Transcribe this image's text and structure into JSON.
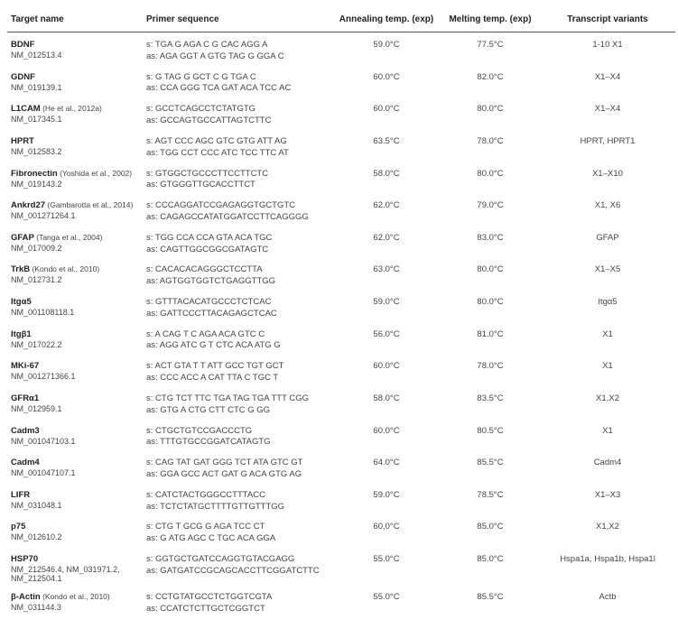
{
  "headers": {
    "target": "Target name",
    "primer": "Primer sequence",
    "anneal": "Annealing temp. (exp)",
    "melt": "Melting temp. (exp)",
    "variants": "Transcript variants"
  },
  "rows": [
    {
      "name": "BDNF",
      "ref": "",
      "accession": "NM_012513.4",
      "s": "s: TGA G AGA C G CAC AGG A",
      "as": "as: AGA GGT A GTG TAG G GGA C",
      "anneal": "59.0°C",
      "melt": "77.5°C",
      "variants": "1-10 X1"
    },
    {
      "name": "GDNF",
      "ref": "",
      "accession": "NM_019139.1",
      "s": "s: G TAG G GCT C G TGA C",
      "as": "as: CCA GGG TCA GAT ACA TCC AC",
      "anneal": "60.0°C",
      "melt": "82.0°C",
      "variants": "X1–X4"
    },
    {
      "name": "L1CAM",
      "ref": "(He et al., 2012a)",
      "accession": "NM_017345.1",
      "s": "s: GCCTCAGCCTCTATGTG",
      "as": "as: GCCAGTGCCATTAGTCTTC",
      "anneal": "60.0°C",
      "melt": "80.0°C",
      "variants": "X1–X4"
    },
    {
      "name": "HPRT",
      "ref": "",
      "accession": "NM_012583.2",
      "s": "s: AGT CCC AGC GTC GTG ATT AG",
      "as": "as: TGG CCT CCC ATC TCC TTC AT",
      "anneal": "63.5°C",
      "melt": "78.0°C",
      "variants": "HPRT, HPRT1"
    },
    {
      "name": "Fibronectin",
      "ref": "(Yoshida et al., 2002)",
      "accession": "NM_019143.2",
      "s": "s: GTGGCTGCCCTTCCTTCTC",
      "as": "as: GTGGGTTGCACCTTCT",
      "anneal": "58.0°C",
      "melt": "80.0°C",
      "variants": "X1–X10"
    },
    {
      "name": "Ankrd27",
      "ref": "(Gambarotta et al., 2014)",
      "accession": "NM_001271264.1",
      "s": "s: CCCAGGATCCGAGAGGTGCTGTC",
      "as": "as: CAGAGCCATATGGATCCTTCAGGGG",
      "anneal": "62.0°C",
      "melt": "79.0°C",
      "variants": "X1, X6"
    },
    {
      "name": "GFAP",
      "ref": "(Tanga et al., 2004)",
      "accession": "NM_017009.2",
      "s": "s: TGG CCA CCA GTA ACA TGC",
      "as": "as: CAGTTGGCGGCGATAGTC",
      "anneal": "62.0°C",
      "melt": "83.0°C",
      "variants": "GFAP"
    },
    {
      "name": "TrkB",
      "ref": "(Kondo et al., 2010)",
      "accession": "NM_012731.2",
      "s": "s: CACACACAGGGCTCCTTA",
      "as": "as: AGTGGTGGTCTGAGGTTGG",
      "anneal": "63.0°C",
      "melt": "80.0°C",
      "variants": "X1–X5"
    },
    {
      "name": "Itgα5",
      "ref": "",
      "accession": "NM_001108118.1",
      "s": "s: GTTTACACATGCCCTCTCAC",
      "as": "as: GATTCCCTTACAGAGCTCAC",
      "anneal": "59.0°C",
      "melt": "80.0°C",
      "variants": "Itgα5"
    },
    {
      "name": "Itgβ1",
      "ref": "",
      "accession": "NM_017022.2",
      "s": "s: A CAG T C AGA ACA GTC C",
      "as": "as: AGG ATC G T CTC ACA ATG G",
      "anneal": "56.0°C",
      "melt": "81.0°C",
      "variants": "X1"
    },
    {
      "name": "MKi-67",
      "ref": "",
      "accession": "NM_001271366.1",
      "s": "s: ACT GTA T T ATT GCC TGT GCT",
      "as": "as: CCC ACC A CAT TTA C TGC T",
      "anneal": "60.0°C",
      "melt": "78.0°C",
      "variants": "X1"
    },
    {
      "name": "GFRα1",
      "ref": "",
      "accession": "NM_012959.1",
      "s": "s: CTG TCT TTC TGA TAG TGA TTT CGG",
      "as": "as: GTG A CTG CTT CTC G GG",
      "anneal": "58.0°C",
      "melt": "83.5°C",
      "variants": "X1,X2"
    },
    {
      "name": "Cadm3",
      "ref": "",
      "accession": "NM_001047103.1",
      "s": "s: CTGCTGTCCGACCCTG",
      "as": "as: TTTGTGCCGGATCATAGTG",
      "anneal": "60.0°C",
      "melt": "80.5°C",
      "variants": "X1"
    },
    {
      "name": "Cadm4",
      "ref": "",
      "accession": "NM_001047107.1",
      "s": "s: CAG TAT GAT GGG TCT ATA GTC GT",
      "as": "as: GGA GCC ACT GAT G ACA GTG AG",
      "anneal": "64.0°C",
      "melt": "85.5°C",
      "variants": "Cadm4"
    },
    {
      "name": "LIFR",
      "ref": "",
      "accession": "NM_031048.1",
      "s": "s: CATCTACTGGGCCTTTACC",
      "as": "as: TCTCTATGCTTTTGTTGTTTGG",
      "anneal": "59.0°C",
      "melt": "78.5°C",
      "variants": "X1–X3"
    },
    {
      "name": "p75",
      "ref": "",
      "accession": "NM_012610.2",
      "s": "s: CTG T GCG G AGA TCC CT",
      "as": "as: G ATG AGC C TGC ACA GGA",
      "anneal": "60,0°C",
      "melt": "85.0°C",
      "variants": "X1,X2"
    },
    {
      "name": "HSP70",
      "ref": "",
      "accession": "NM_212546.4, NM_031971.2, NM_212504.1",
      "s": "s: GGTGCTGATCCAGGTGTACGAGG",
      "as": "as: GATGATCCGCAGCACCTTCGGATCTTC",
      "anneal": "55.0°C",
      "melt": "85.0°C",
      "variants": "Hspa1a, Hspa1b, Hspa1l"
    },
    {
      "name": "β-Actin",
      "ref": "(Kondo et al., 2010)",
      "accession": "NM_031144.3",
      "s": "s: CCTGTATGCCTCTGGTCGTA",
      "as": "as: CCATCTCTTGCTCGGTCT",
      "anneal": "55.0°C",
      "melt": "85.5°C",
      "variants": "Actb"
    }
  ]
}
